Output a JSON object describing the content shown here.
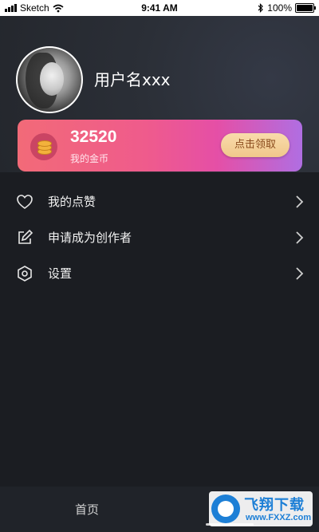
{
  "status_bar": {
    "carrier": "Sketch",
    "time": "9:41 AM",
    "battery": "100%"
  },
  "profile": {
    "username": "用户名xxx"
  },
  "coins": {
    "count": "32520",
    "label": "我的金币",
    "claim_button": "点击领取"
  },
  "menu": {
    "items": [
      {
        "label": "我的点赞",
        "icon": "heart-icon"
      },
      {
        "label": "申请成为创作者",
        "icon": "edit-icon"
      },
      {
        "label": "设置",
        "icon": "settings-hexagon-icon"
      }
    ]
  },
  "tab_bar": {
    "home_label": "首页"
  },
  "watermark": {
    "title": "飞翔下载",
    "url": "www.FXXZ.com"
  },
  "colors": {
    "background": "#1b1d22",
    "card_gradient_start": "#f26a78",
    "card_gradient_end": "#b06ee2",
    "claim_button": "#f0c78b"
  }
}
